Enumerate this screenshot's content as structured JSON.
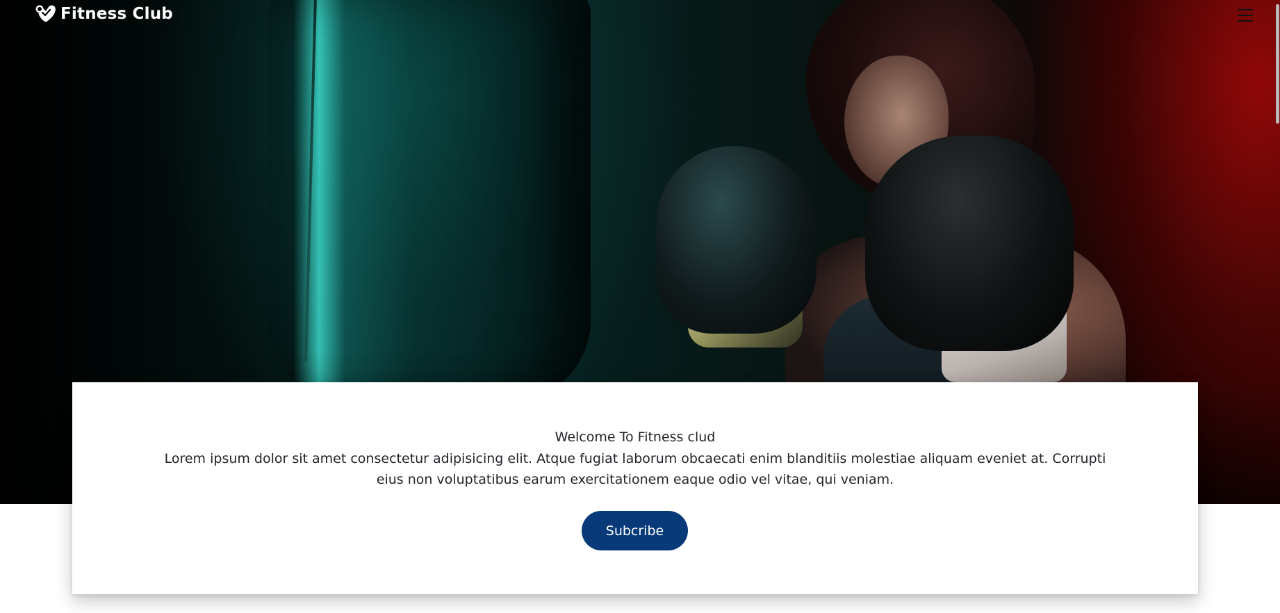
{
  "navbar": {
    "brand_name": "Fitness Club",
    "brand_icon": "heart-check-icon",
    "menu_icon": "hamburger-menu-icon"
  },
  "hero": {
    "image_description_icon": "boxer-with-punching-bag-photo"
  },
  "welcome": {
    "title": "Welcome To Fitness clud",
    "body": "Lorem ipsum dolor sit amet consectetur adipisicing elit. Atque fugiat laborum obcaecati enim blanditiis molestiae aliquam eveniet at. Corrupti eius non voluptatibus earum exercitationem eaque odio vel vitae, qui veniam.",
    "subscribe_label": "Subcribe"
  },
  "colors": {
    "primary_button": "#083a7a",
    "text": "#212529",
    "card_background": "#ffffff",
    "hero_teal": "#128076",
    "hero_red": "#960808"
  }
}
